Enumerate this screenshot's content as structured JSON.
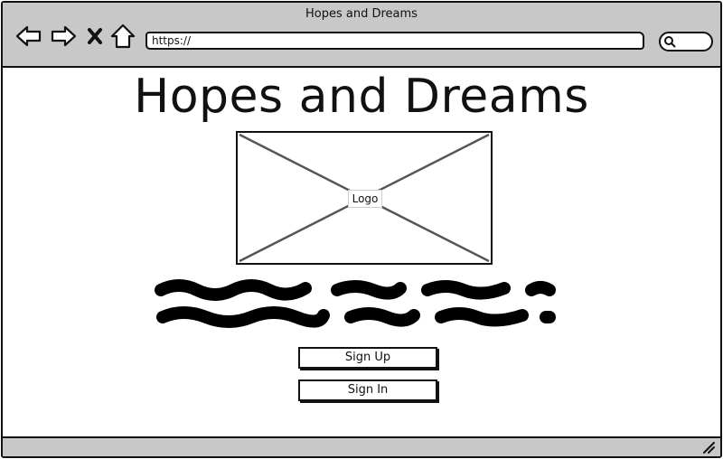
{
  "window": {
    "title": "Hopes and Dreams"
  },
  "toolbar": {
    "back_icon": "arrow-left-icon",
    "forward_icon": "arrow-right-icon",
    "stop_icon": "close-icon",
    "home_icon": "home-icon",
    "address": "https://",
    "search_icon": "search-icon"
  },
  "page": {
    "heading": "Hopes and Dreams",
    "logo_label": "Logo",
    "signup_label": "Sign Up",
    "signin_label": "Sign In"
  }
}
